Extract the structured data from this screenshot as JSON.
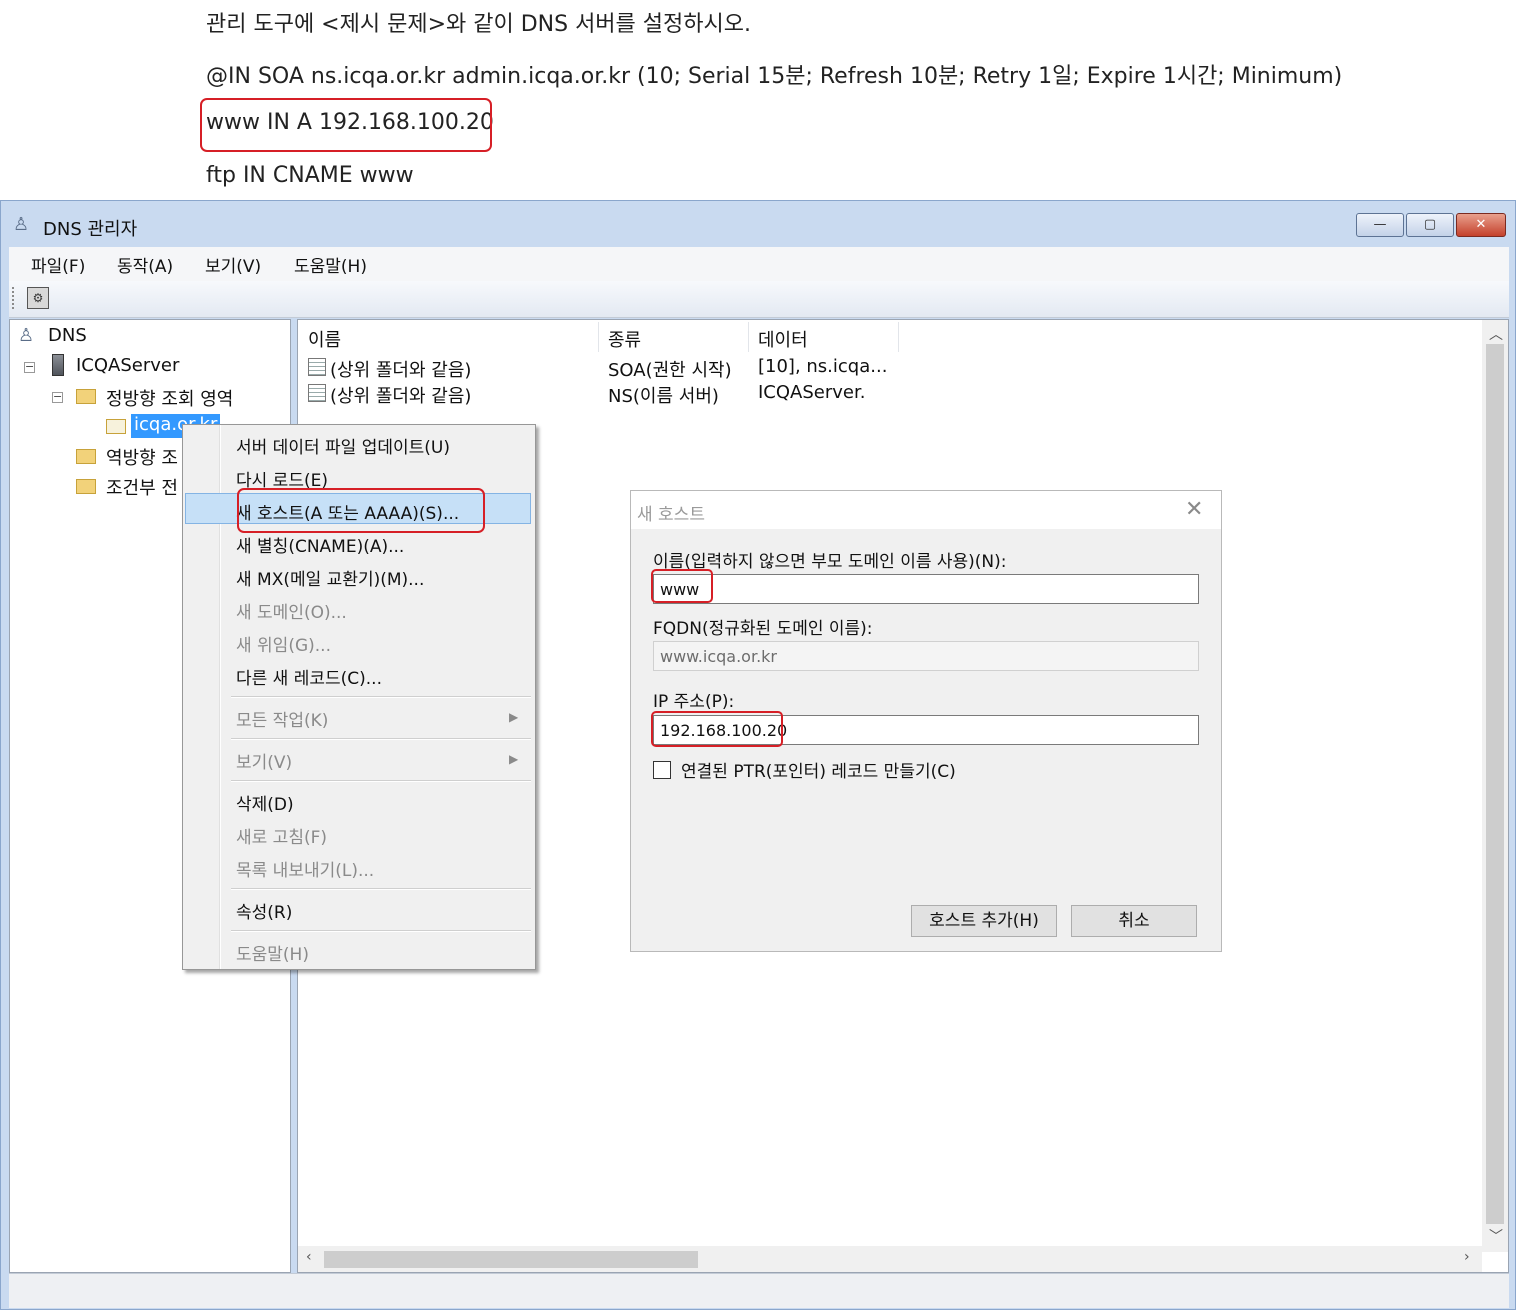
{
  "instructions": {
    "line1": "관리 도구에 <제시 문제>와 같이 DNS 서버를 설정하시오.",
    "line2": "@IN SOA ns.icqa.or.kr admin.icqa.or.kr (10; Serial 15분; Refresh 10분; Retry 1일; Expire 1시간; Minimum)",
    "line3": "www IN A 192.168.100.20",
    "line4": "ftp IN CNAME www"
  },
  "window": {
    "title": "DNS 관리자",
    "controls": {
      "minimize": "—",
      "maximize": "▢",
      "close": "✕"
    }
  },
  "menubar": {
    "file": "파일(F)",
    "action": "동작(A)",
    "view": "보기(V)",
    "help": "도움말(H)"
  },
  "tree": {
    "root": "DNS",
    "server": "ICQAServer",
    "forward_zone": "정방향 조회 영역",
    "zone": "icqa.or.kr",
    "reverse_zone": "역방향 조",
    "conditional": "조건부 전"
  },
  "list": {
    "columns": [
      "이름",
      "종류",
      "데이터"
    ],
    "rows": [
      {
        "name": "(상위 폴더와 같음)",
        "type": "SOA(권한 시작)",
        "data": "[10], ns.icqa..."
      },
      {
        "name": "(상위 폴더와 같음)",
        "type": "NS(이름 서버)",
        "data": "ICQAServer."
      }
    ]
  },
  "context_menu": {
    "update": "서버 데이터 파일 업데이트(U)",
    "reload": "다시 로드(E)",
    "new_host": "새 호스트(A 또는 AAAA)(S)...",
    "new_alias": "새 별칭(CNAME)(A)...",
    "new_mx": "새 MX(메일 교환기)(M)...",
    "new_domain": "새 도메인(O)...",
    "new_delegation": "새 위임(G)...",
    "other_records": "다른 새 레코드(C)...",
    "all_tasks": "모든 작업(K)",
    "view": "보기(V)",
    "delete": "삭제(D)",
    "refresh": "새로 고침(F)",
    "export": "목록 내보내기(L)...",
    "properties": "속성(R)",
    "help": "도움말(H)"
  },
  "dialog": {
    "title": "새 호스트",
    "name_label": "이름(입력하지 않으면 부모 도메인 이름 사용)(N):",
    "name_value": "www",
    "fqdn_label": "FQDN(정규화된 도메인 이름):",
    "fqdn_value": "www.icqa.or.kr",
    "ip_label": "IP 주소(P):",
    "ip_value": "192.168.100.20",
    "ptr_label": "연결된 PTR(포인터) 레코드 만들기(C)",
    "ptr_checked": false,
    "add_button": "호스트 추가(H)",
    "cancel_button": "취소"
  },
  "colors": {
    "highlight_box": "#d61f26",
    "selection": "#3399ff",
    "menu_hover": "#c6e0f7"
  }
}
